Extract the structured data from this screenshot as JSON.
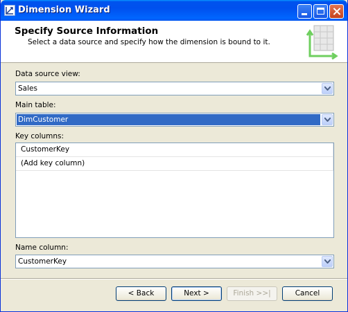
{
  "window": {
    "title": "Dimension Wizard"
  },
  "header": {
    "title": "Specify Source Information",
    "subtitle": "Select a data source and specify how the dimension is bound to it."
  },
  "form": {
    "data_source_view": {
      "label": "Data source view:",
      "value": "Sales"
    },
    "main_table": {
      "label": "Main table:",
      "value": "DimCustomer"
    },
    "key_columns": {
      "label": "Key columns:",
      "rows": [
        "CustomerKey",
        "(Add key column)"
      ]
    },
    "name_column": {
      "label": "Name column:",
      "value": "CustomerKey"
    }
  },
  "buttons": {
    "back": "< Back",
    "next": "Next >",
    "finish": "Finish >>|",
    "cancel": "Cancel"
  },
  "colors": {
    "titlebar": "#0053ee",
    "selection": "#316ac5",
    "face": "#ece9d8"
  }
}
